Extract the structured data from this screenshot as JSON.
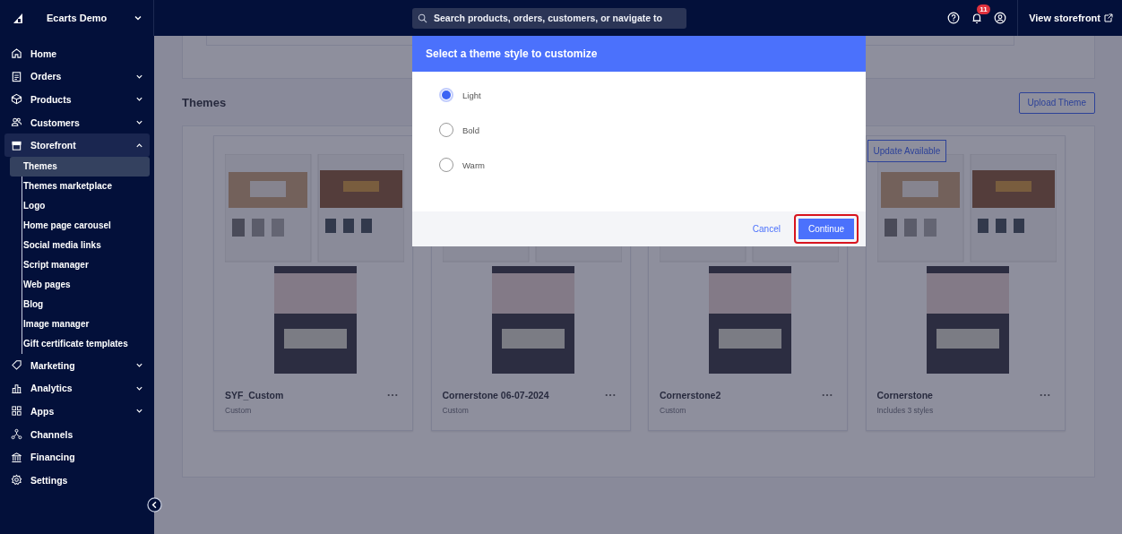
{
  "topbar": {
    "store_name": "Ecarts Demo",
    "search": {
      "placeholder": "Search products, orders, customers, or navigate to"
    },
    "notification_count": "11",
    "storefront_link": "View storefront"
  },
  "sidebar": {
    "items": [
      {
        "label": "Home",
        "kind": "link"
      },
      {
        "label": "Orders",
        "kind": "group",
        "expanded": false
      },
      {
        "label": "Products",
        "kind": "group",
        "expanded": false
      },
      {
        "label": "Customers",
        "kind": "group",
        "expanded": false
      },
      {
        "label": "Storefront",
        "kind": "group",
        "expanded": true,
        "children": [
          {
            "label": "Themes",
            "selected": true
          },
          {
            "label": "Themes marketplace",
            "selected": false
          },
          {
            "label": "Logo",
            "selected": false
          },
          {
            "label": "Home page carousel",
            "selected": false
          },
          {
            "label": "Social media links",
            "selected": false
          },
          {
            "label": "Script manager",
            "selected": false
          },
          {
            "label": "Web pages",
            "selected": false
          },
          {
            "label": "Blog",
            "selected": false
          },
          {
            "label": "Image manager",
            "selected": false
          },
          {
            "label": "Gift certificate templates",
            "selected": false
          }
        ]
      },
      {
        "label": "Marketing",
        "kind": "group",
        "expanded": false
      },
      {
        "label": "Analytics",
        "kind": "group",
        "expanded": false
      },
      {
        "label": "Apps",
        "kind": "group",
        "expanded": false
      },
      {
        "label": "Channels",
        "kind": "link"
      },
      {
        "label": "Financing",
        "kind": "link"
      },
      {
        "label": "Settings",
        "kind": "link"
      }
    ]
  },
  "page": {
    "heading": "Themes",
    "upload_button": "Upload Theme",
    "themes": [
      {
        "name": "SYF_Custom",
        "subtitle": "Custom"
      },
      {
        "name": "Cornerstone 06-07-2024",
        "subtitle": "Custom"
      },
      {
        "name": "Cornerstone2",
        "subtitle": "Custom"
      },
      {
        "name": "Cornerstone",
        "subtitle": "Includes 3 styles",
        "badge": "Update Available"
      }
    ]
  },
  "dialog": {
    "title": "Select a theme style to customize",
    "options": [
      {
        "label": "Light",
        "selected": true
      },
      {
        "label": "Bold",
        "selected": false
      },
      {
        "label": "Warm",
        "selected": false
      }
    ],
    "buttons": [
      {
        "label": "Cancel",
        "kind": "link",
        "highlighted": false
      },
      {
        "label": "Continue",
        "kind": "primary",
        "highlighted": true
      }
    ]
  }
}
